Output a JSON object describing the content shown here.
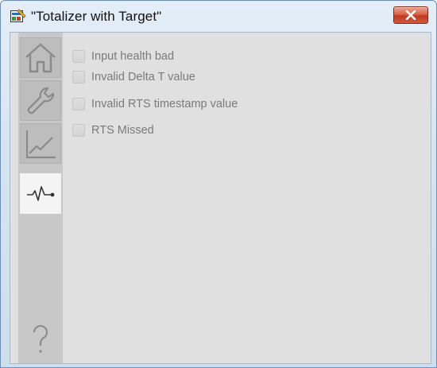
{
  "window": {
    "title": "\"Totalizer with Target\"",
    "title_icon": "faceplate-app-icon",
    "close_icon": "close-icon",
    "accent_close": "#c8432a"
  },
  "nav": {
    "items": [
      {
        "name": "home",
        "icon": "home-icon",
        "active": false
      },
      {
        "name": "maintenance",
        "icon": "wrench-icon",
        "active": false
      },
      {
        "name": "trends",
        "icon": "trend-icon",
        "active": false
      },
      {
        "name": "diagnostics",
        "icon": "pulse-icon",
        "active": true
      }
    ],
    "help_label": "?"
  },
  "alarms": [
    {
      "label": "Input health bad",
      "checked": false
    },
    {
      "label": "Invalid Delta T value",
      "checked": false
    },
    {
      "label": "Invalid RTS timestamp value",
      "checked": false
    },
    {
      "label": "RTS Missed",
      "checked": false
    }
  ]
}
